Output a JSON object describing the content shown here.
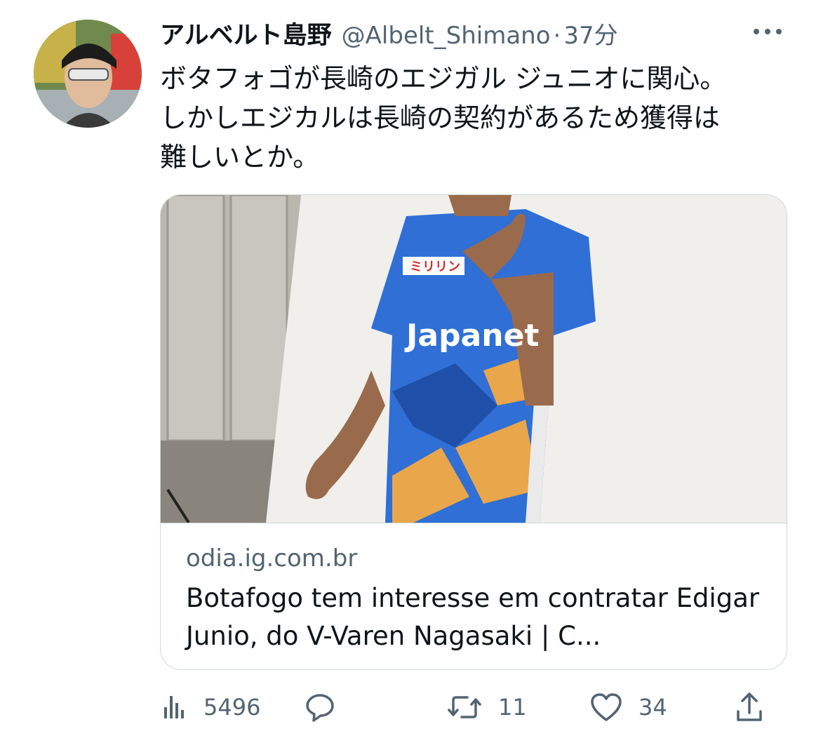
{
  "tweet": {
    "author_name": "アルベルト島野",
    "handle": "@Albelt_Shimano",
    "separator": "·",
    "time": "37分",
    "text": "ボタフォゴが長崎のエジガル ジュニオに関心。\nしかしエジカルは長崎の契約があるため獲得は\n難しいとか。"
  },
  "card": {
    "domain": "odia.ig.com.br",
    "title": "Botafogo tem interesse em contratar Edigar Junio, do V-Varen Nagasaki | C...",
    "image_icon": "jersey-photo",
    "jersey_text": "Japanet",
    "sponsor_text": "ミリリン"
  },
  "actions": {
    "views": "5496",
    "replies": "",
    "retweets": "11",
    "likes": "34",
    "share": ""
  },
  "colors": {
    "text": "#0f1419",
    "secondary": "#536471",
    "border": "#cfd9de",
    "jersey_blue": "#2f6fd6",
    "jersey_orange": "#e9a64a"
  }
}
